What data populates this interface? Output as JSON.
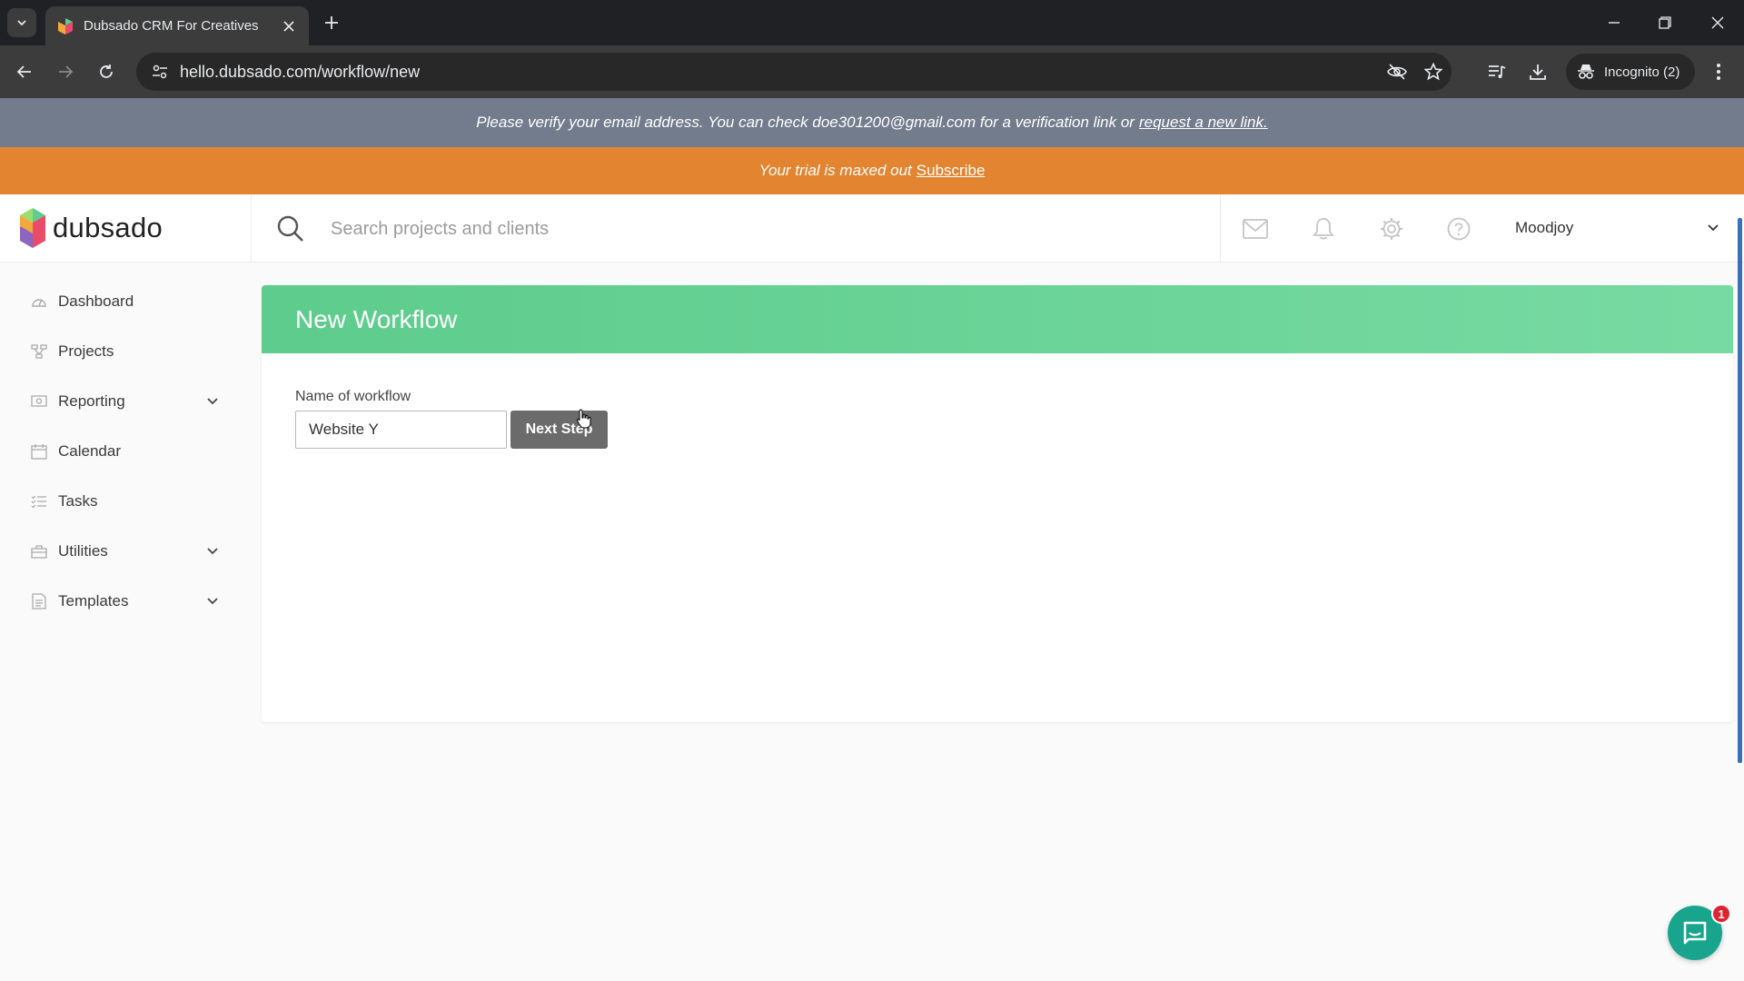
{
  "browser": {
    "tab_title": "Dubsado CRM For Creatives",
    "url": "hello.dubsado.com/workflow/new",
    "incognito_label": "Incognito (2)"
  },
  "banners": {
    "verify_text": "Please verify your email address. You can check doe301200@gmail.com for a verification link or",
    "verify_link": "request a new link.",
    "trial_text": "Your trial is maxed out",
    "trial_link": "Subscribe"
  },
  "header": {
    "logo_text": "dubsado",
    "search_placeholder": "Search projects and clients",
    "user_name": "Moodjoy",
    "icons": [
      "mail-icon",
      "bell-icon",
      "gear-icon",
      "help-icon"
    ]
  },
  "sidebar": {
    "items": [
      {
        "label": "Dashboard",
        "icon": "dashboard-icon",
        "has_chevron": false
      },
      {
        "label": "Projects",
        "icon": "projects-icon",
        "has_chevron": false
      },
      {
        "label": "Reporting",
        "icon": "reporting-icon",
        "has_chevron": true
      },
      {
        "label": "Calendar",
        "icon": "calendar-icon",
        "has_chevron": false
      },
      {
        "label": "Tasks",
        "icon": "tasks-icon",
        "has_chevron": false
      },
      {
        "label": "Utilities",
        "icon": "utilities-icon",
        "has_chevron": true
      },
      {
        "label": "Templates",
        "icon": "templates-icon",
        "has_chevron": true
      }
    ]
  },
  "main": {
    "title": "New Workflow",
    "field_label": "Name of workflow",
    "field_value": "Website Y",
    "next_button": "Next Step"
  },
  "chat": {
    "badge_count": "1"
  },
  "colors": {
    "header_green": "#5dcc8c",
    "trial_orange": "#e28430",
    "verify_gray": "#727c8c",
    "chat_teal": "#19a58d"
  }
}
